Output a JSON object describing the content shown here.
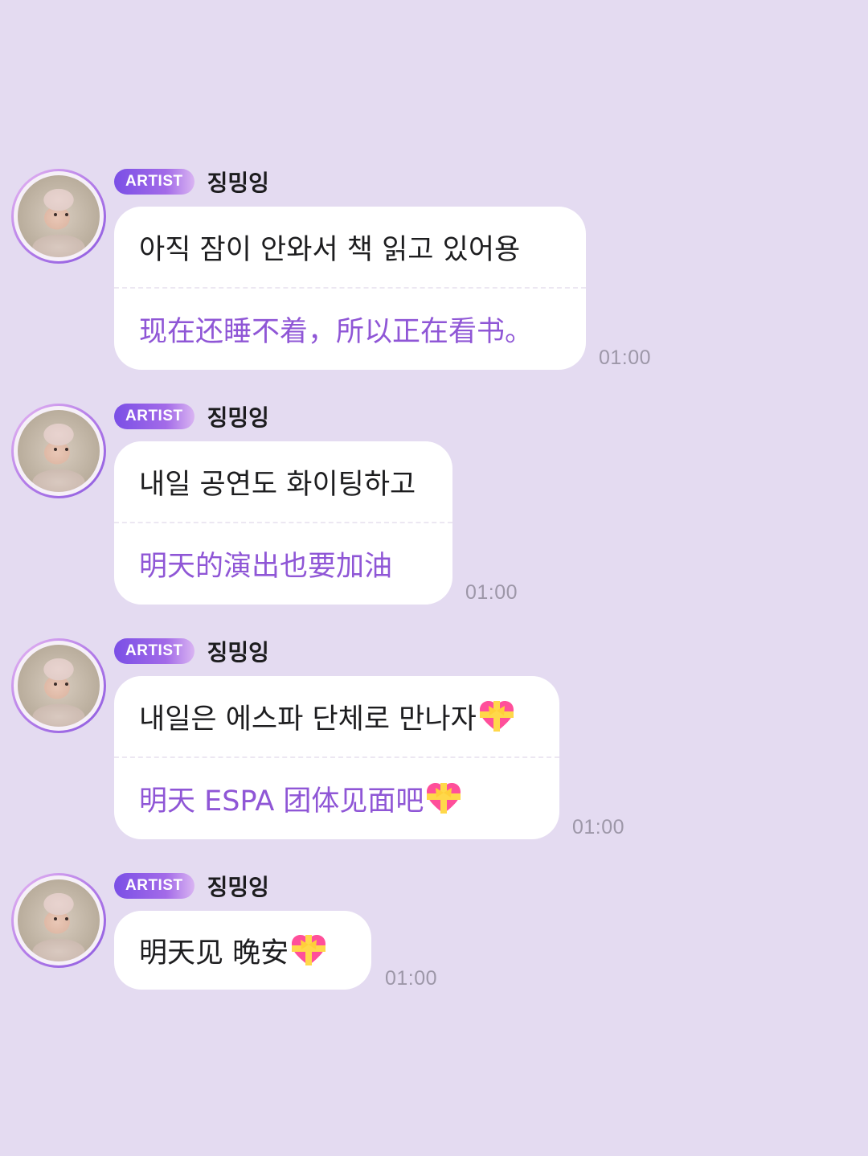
{
  "colors": {
    "background": "#e4dbf1",
    "bubble": "#ffffff",
    "korean_text": "#1d1d1f",
    "chinese_text": "#8f56d6",
    "badge_start": "#7a4fe6",
    "badge_end": "#d9b4f2",
    "time_text": "#9d97a8"
  },
  "messages": [
    {
      "badge": "ARTIST",
      "sender": "징밍잉",
      "korean": "아직 잠이 안와서 책 읽고 있어용",
      "chinese": "现在还睡不着，所以正在看书。",
      "time": "01:00"
    },
    {
      "badge": "ARTIST",
      "sender": "징밍잉",
      "korean": "내일 공연도 화이팅하고",
      "chinese": "明天的演出也要加油",
      "time": "01:00"
    },
    {
      "badge": "ARTIST",
      "sender": "징밍잉",
      "korean": "내일은 에스파 단체로 만나자",
      "chinese": "明天 ESPA 团体见面吧",
      "time": "01:00",
      "icon": "gift-heart-icon"
    },
    {
      "badge": "ARTIST",
      "sender": "징밍잉",
      "korean": "明天见 晚安",
      "time": "01:00",
      "icon": "gift-heart-icon"
    }
  ]
}
